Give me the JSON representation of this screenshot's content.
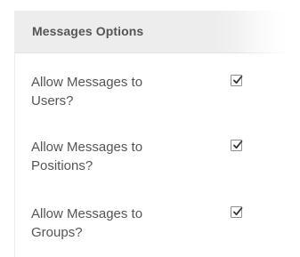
{
  "panel": {
    "title": "Messages Options"
  },
  "options": [
    {
      "label_line1": "Allow Messages to",
      "label_line2": "Users?",
      "checked": true
    },
    {
      "label_line1": "Allow Messages to",
      "label_line2": "Positions?",
      "checked": true
    },
    {
      "label_line1": "Allow Messages to",
      "label_line2": "Groups?",
      "checked": true
    }
  ],
  "icons": {
    "check": "check-icon"
  },
  "colors": {
    "header_bg": "#ededed",
    "text": "#555555",
    "checkbox_border": "#8e8e8e",
    "check_mark": "#333333"
  }
}
